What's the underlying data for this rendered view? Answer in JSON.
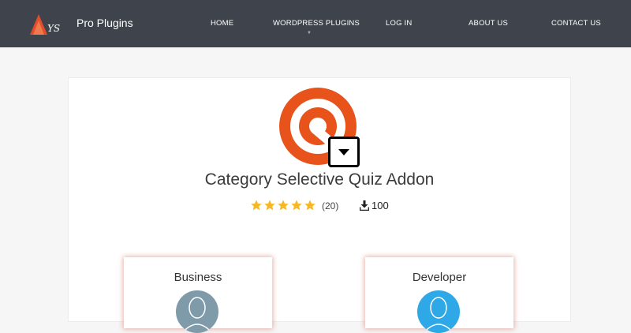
{
  "header": {
    "brand": "Pro Plugins",
    "nav": [
      {
        "label": "HOME"
      },
      {
        "label": "WORDPRESS PLUGINS"
      },
      {
        "label": "LOG IN"
      },
      {
        "label": "ABOUT US"
      },
      {
        "label": "CONTACT US"
      }
    ]
  },
  "product": {
    "title": "Category Selective Quiz Addon",
    "rating": 5,
    "rating_count": "(20)",
    "downloads": "100"
  },
  "plans": [
    {
      "name": "Business"
    },
    {
      "name": "Developer"
    }
  ],
  "colors": {
    "header_bg": "#3f444c",
    "icon_orange": "#e8531c",
    "star": "#f6b824",
    "business_avatar": "#7f9aa8",
    "developer_avatar": "#2ea8e6"
  }
}
